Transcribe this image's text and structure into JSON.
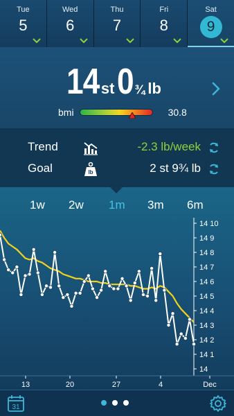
{
  "days": [
    {
      "name": "Tue",
      "number": "5"
    },
    {
      "name": "Wed",
      "number": "6"
    },
    {
      "name": "Thu",
      "number": "7"
    },
    {
      "name": "Fri",
      "number": "8"
    },
    {
      "name": "Sat",
      "number": "9",
      "active": true
    }
  ],
  "weight": {
    "stones": "14",
    "stone_unit": "st",
    "pounds": "0",
    "fraction": "¾",
    "pound_unit": "lb"
  },
  "bmi": {
    "label": "bmi",
    "value": "30.8"
  },
  "trend": {
    "label": "Trend",
    "value": "-2.3 lb/week",
    "icon": "trend-chart-icon"
  },
  "goal": {
    "label": "Goal",
    "value": "2 st 9¾ lb",
    "icon": "weight-lb-icon"
  },
  "range_tabs": [
    {
      "label": "1w"
    },
    {
      "label": "2w"
    },
    {
      "label": "1m",
      "active": true
    },
    {
      "label": "3m"
    },
    {
      "label": "6m"
    }
  ],
  "colors": {
    "accent": "#3fb7d8",
    "trend_value": "#8fd13b",
    "trend_line": "#f2d21b",
    "weight_line": "#ffffff"
  },
  "chart_data": {
    "type": "line",
    "y_unit": "stone",
    "x_tick_labels": [
      "13",
      "20",
      "27",
      "4",
      "Dec"
    ],
    "y_tick_labels": [
      "14 10",
      "14 9",
      "14 8",
      "14 7",
      "14 6",
      "14 5",
      "14 4",
      "14 3",
      "14 2",
      "14 1",
      "14"
    ],
    "ylim_lb": [
      196,
      206
    ],
    "series": [
      {
        "values_lb": [
          205.2,
          203.5,
          202.8,
          202.6,
          203.0,
          201.1,
          202.4,
          202.5,
          204.2,
          202.6,
          201.1,
          201.7,
          201.6,
          204.0,
          201.7,
          200.9,
          201.1,
          200.3,
          201.2,
          201.2,
          202.0,
          202.4,
          201.5,
          200.9,
          201.4,
          202.7,
          201.7,
          201.5,
          201.5,
          202.2,
          201.7,
          200.7,
          201.9,
          202.7,
          201.1,
          201.0,
          202.9,
          200.7,
          203.9,
          201.4,
          199.0,
          199.8,
          197.7,
          198.4,
          198.1,
          199.4,
          197.7
        ]
      },
      {
        "values_lb": [
          205.5,
          205.0,
          204.6,
          204.4,
          204.2,
          203.9,
          203.6,
          203.5,
          203.6,
          203.4,
          203.3,
          203.1,
          202.9,
          202.8,
          202.7,
          202.5,
          202.4,
          202.3,
          202.2,
          202.2,
          202.1,
          202.0,
          202.0,
          202.0,
          201.9,
          201.9,
          201.8,
          201.8,
          201.8,
          201.8,
          201.8,
          201.7,
          201.7,
          201.6,
          201.5,
          201.5,
          201.6,
          201.5,
          201.7,
          201.6,
          201.3,
          201.0,
          200.5,
          200.1,
          199.8,
          199.5,
          199.2
        ]
      }
    ]
  }
}
